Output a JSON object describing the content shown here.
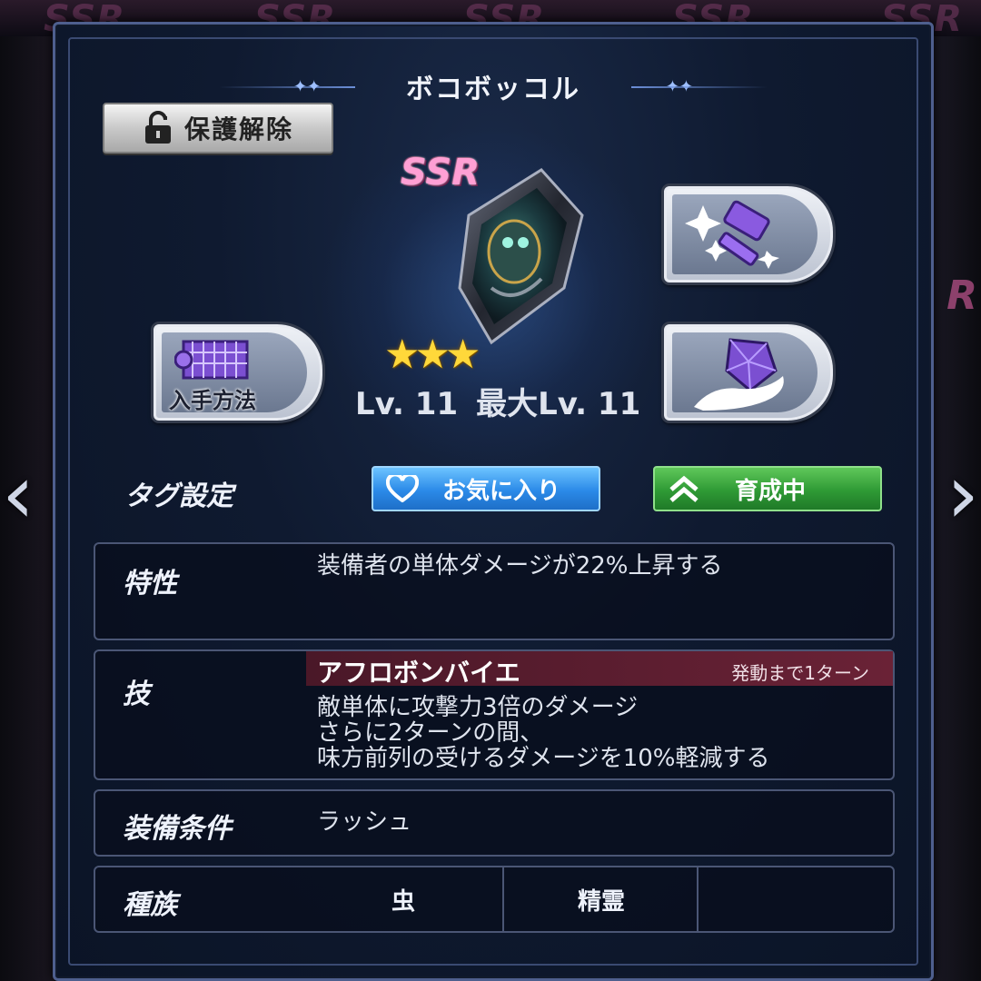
{
  "background": {
    "tile_label": "SSR",
    "peek_text": "R"
  },
  "navigation": {
    "prev_glyph": "‹",
    "next_glyph": "›"
  },
  "item": {
    "name": "ボコボッコル",
    "rarity": "SSR",
    "stars": 3,
    "stars_display": "★★★",
    "level_text": "Lv. 11",
    "max_level_text": "最大Lv. 11"
  },
  "buttons": {
    "unlock_label": "保護解除",
    "acquisition_label": "入手方法",
    "forge_icon": "hammer-sparkle-icon",
    "gem_icon": "gem-hand-icon"
  },
  "tags": {
    "label": "タグ設定",
    "favorite_label": "お気に入り",
    "training_label": "育成中"
  },
  "trait": {
    "label": "特性",
    "text": "装備者の単体ダメージが22%上昇する"
  },
  "skill": {
    "label": "技",
    "name": "アフロボンバイエ",
    "cooldown": "発動まで1ターン",
    "description_lines": [
      "敵単体に攻撃力3倍のダメージ",
      "さらに2ターンの間、",
      "味方前列の受けるダメージを10%軽減する"
    ]
  },
  "condition": {
    "label": "装備条件",
    "value": "ラッシュ"
  },
  "race": {
    "label": "種族",
    "values": [
      "虫",
      "精霊",
      ""
    ]
  },
  "colors": {
    "panel_bg": "#0f1a30",
    "favorite_blue": "#2b8ae8",
    "training_green": "#2f9a35",
    "skill_bar": "#6a2236",
    "rarity_pink": "#ff9fd4",
    "star_gold": "#ffd83a"
  }
}
